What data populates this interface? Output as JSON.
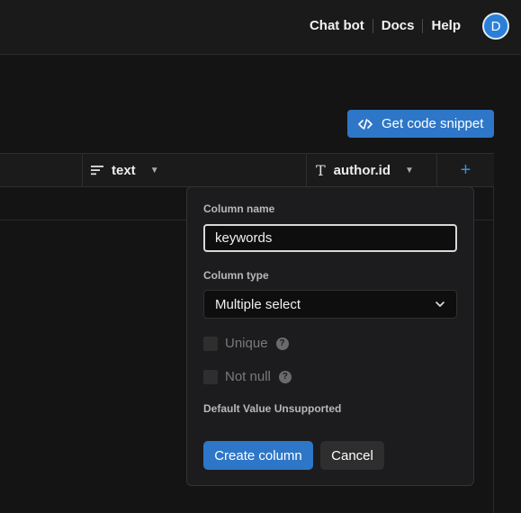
{
  "nav": {
    "items": [
      "Chat bot",
      "Docs",
      "Help"
    ]
  },
  "user": {
    "avatar_initial": "D"
  },
  "toolbar": {
    "snippet_label": "Get code snippet"
  },
  "columns": [
    {
      "label": "text",
      "icon": "text-lines-icon"
    },
    {
      "label": "author.id",
      "icon": "text-type-icon"
    }
  ],
  "add_column": {
    "icon": "plus-icon"
  },
  "popover": {
    "name_label": "Column name",
    "name_value": "keywords",
    "type_label": "Column type",
    "type_value": "Multiple select",
    "unique_label": "Unique",
    "notnull_label": "Not null",
    "default_label": "Default Value Unsupported",
    "create_label": "Create column",
    "cancel_label": "Cancel"
  },
  "colors": {
    "accent": "#2e76c7",
    "background": "#141414"
  }
}
